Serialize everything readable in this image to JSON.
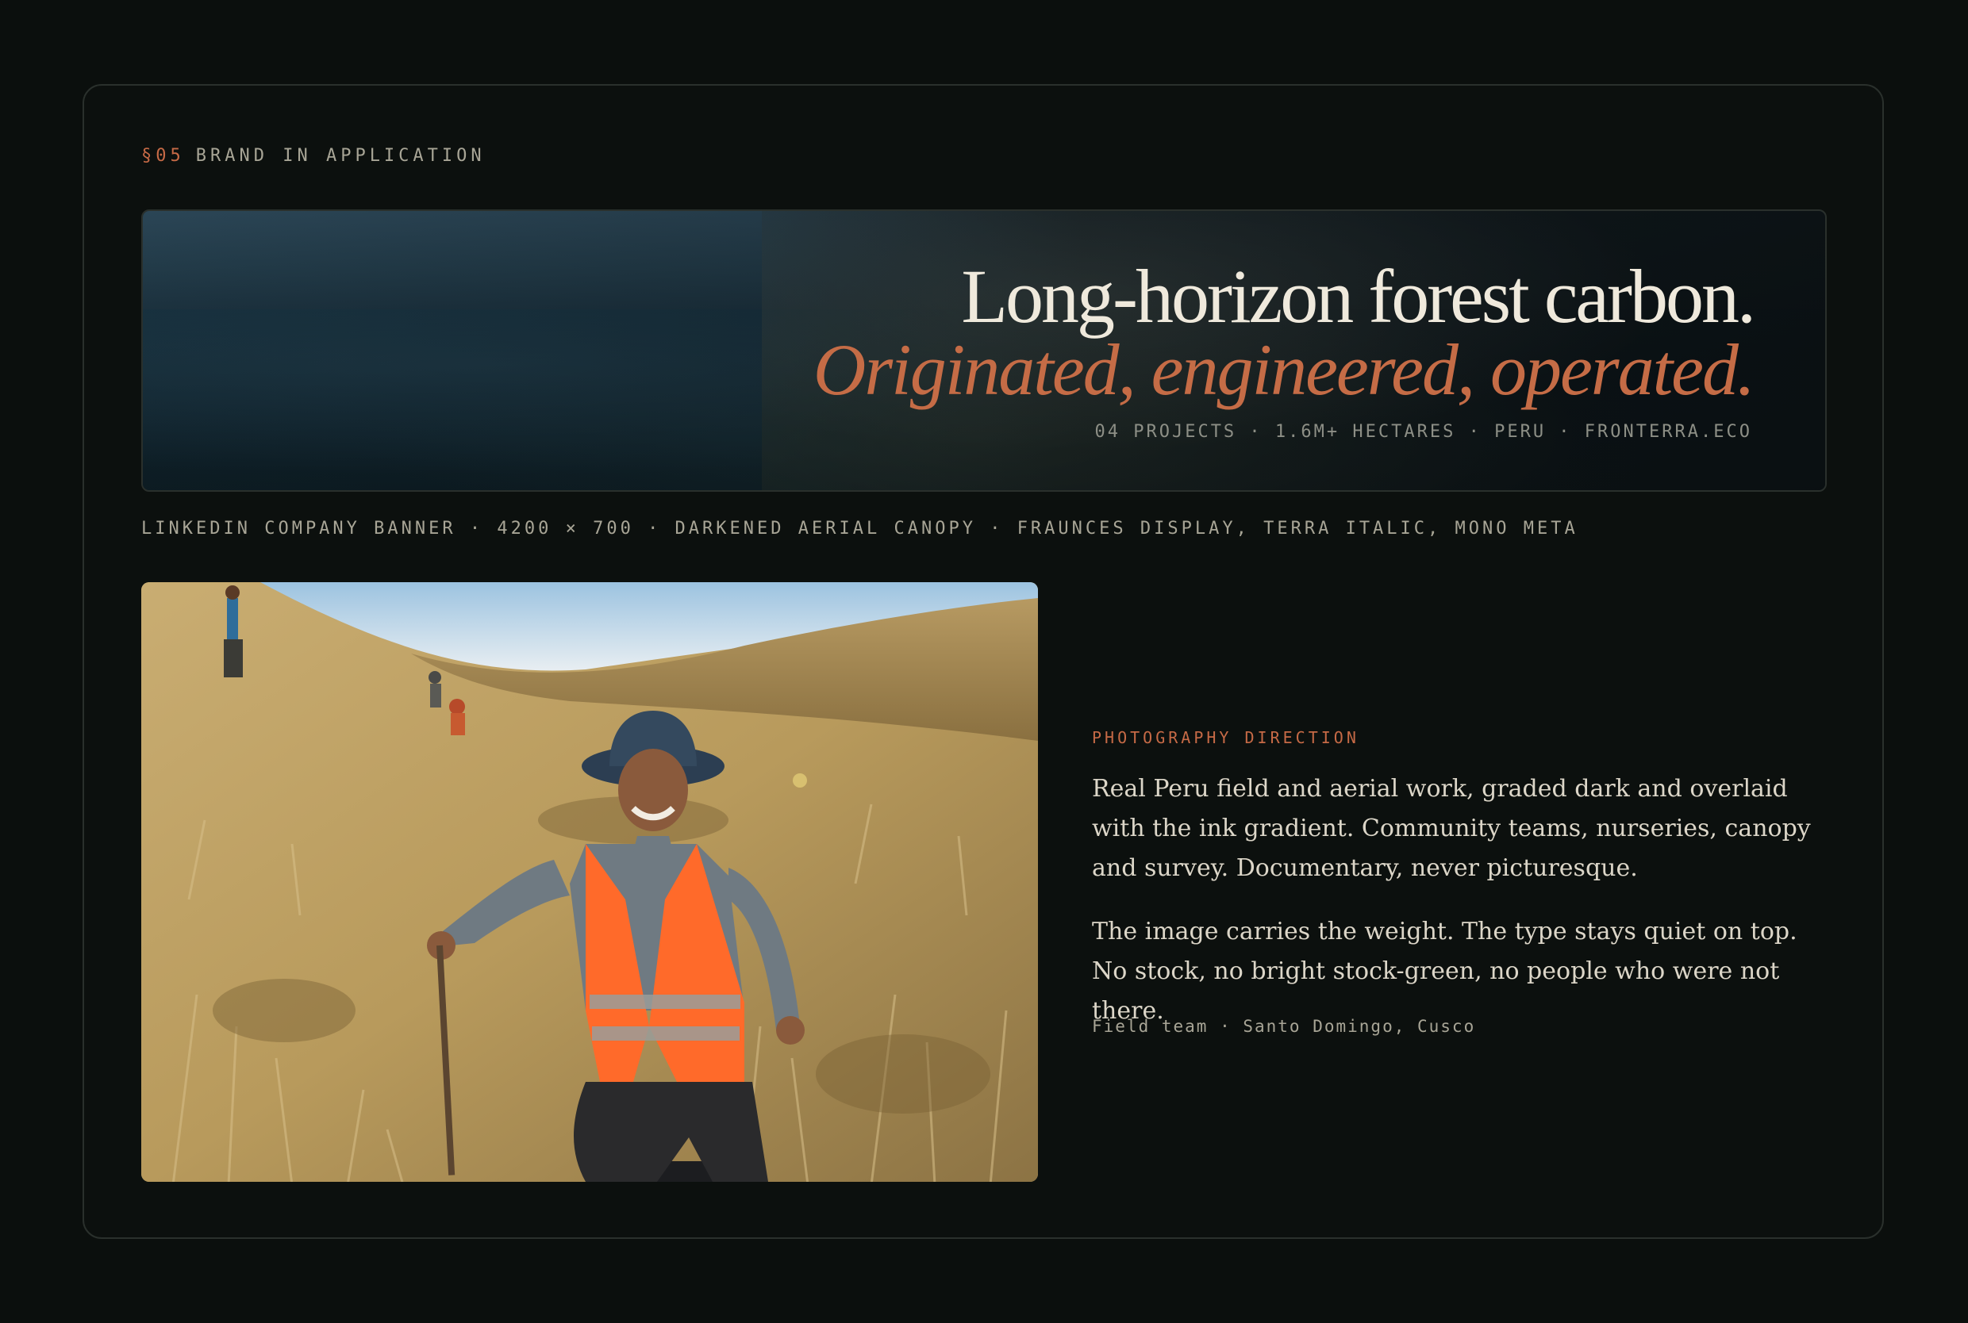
{
  "section": {
    "number": "§05",
    "title": "BRAND IN APPLICATION"
  },
  "banner": {
    "headline": "Long-horizon forest carbon.",
    "tagline": "Originated, engineered, operated.",
    "meta": "04 PROJECTS · 1.6M+ HECTARES · PERU · FRONTERRA.ECO"
  },
  "banner_caption": "LINKEDIN COMPANY BANNER · 4200 × 700 · DARKENED AERIAL CANOPY · FRAUNCES DISPLAY, TERRA ITALIC, MONO META",
  "photography": {
    "label": "PHOTOGRAPHY DIRECTION",
    "paragraph_1": "Real Peru field and aerial work, graded dark and overlaid with the ink gradient. Community teams, nurseries, canopy and survey. Documentary, never picturesque.",
    "paragraph_2": "The image carries the weight. The type stays quiet on top. No stock, no bright stock-green, no people who were not there.",
    "credit": "Field team · Santo Domingo, Cusco"
  },
  "colors": {
    "background": "#0b0f0d",
    "accent": "#c66a46",
    "headline": "#efe9dc",
    "muted": "#a8a596",
    "body": "#dcd6c8"
  }
}
